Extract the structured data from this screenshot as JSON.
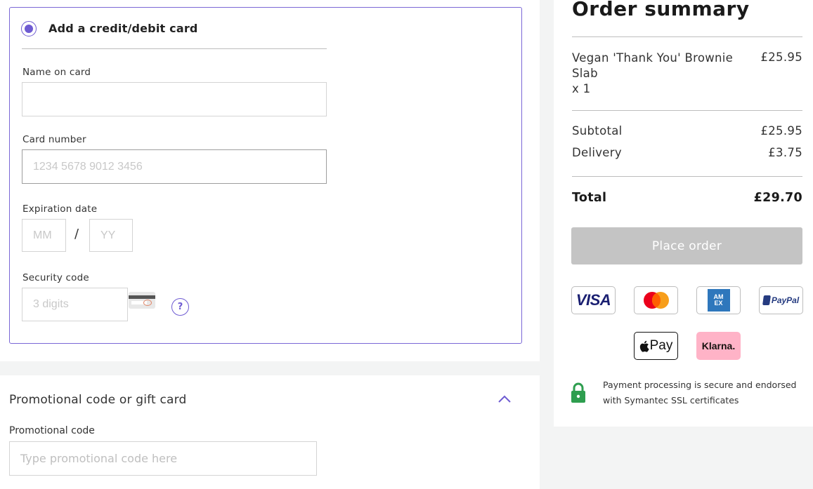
{
  "card_form": {
    "option_label": "Add a credit/debit card",
    "name_label": "Name on card",
    "name_value": "",
    "number_label": "Card number",
    "number_placeholder": "1234 5678 9012 3456",
    "expiry_label": "Expiration date",
    "month_placeholder": "MM",
    "separator": "/",
    "year_placeholder": "YY",
    "security_label": "Security code",
    "security_placeholder": "3 digits",
    "help_symbol": "?"
  },
  "promo": {
    "title": "Promotional code or gift card",
    "code_label": "Promotional code",
    "code_placeholder": "Type promotional code here"
  },
  "summary": {
    "title": "Order summary",
    "item": {
      "name": "Vegan 'Thank You' Brownie Slab",
      "quantity": "x 1",
      "price": "£25.95"
    },
    "subtotal_label": "Subtotal",
    "subtotal_value": "£25.95",
    "delivery_label": "Delivery",
    "delivery_value": "£3.75",
    "total_label": "Total",
    "total_value": "£29.70",
    "place_order_label": "Place order",
    "payment_methods": {
      "visa": "VISA",
      "amex": "AM EX",
      "paypal": "PayPal",
      "applepay": "Pay",
      "klarna": "Klarna."
    },
    "secure_text": "Payment processing is secure and endorsed with Symantec SSL certificates"
  },
  "colors": {
    "accent": "#6e5bd2",
    "disabled_button": "#c4c4c4",
    "lock_green": "#2e9e4f",
    "klarna_pink": "#ffb3c7"
  }
}
